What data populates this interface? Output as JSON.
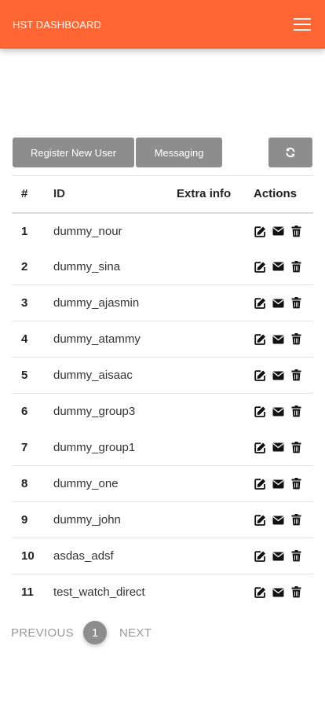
{
  "header": {
    "title": "HST DASHBOARD",
    "menu_icon": "hamburger-menu-icon",
    "background": "#ff6633"
  },
  "toolbar": {
    "register_label": "Register New User",
    "messaging_label": "Messaging",
    "refresh_icon": "refresh-icon"
  },
  "table": {
    "headers": [
      "#",
      "ID",
      "Extra info",
      "Actions"
    ],
    "rows": [
      {
        "num": "1",
        "id": "dummy_nour",
        "extra": ""
      },
      {
        "num": "2",
        "id": "dummy_sina",
        "extra": ""
      },
      {
        "num": "3",
        "id": "dummy_ajasmin",
        "extra": ""
      },
      {
        "num": "4",
        "id": "dummy_atammy",
        "extra": ""
      },
      {
        "num": "5",
        "id": "dummy_aisaac",
        "extra": ""
      },
      {
        "num": "6",
        "id": "dummy_group3",
        "extra": ""
      },
      {
        "num": "7",
        "id": "dummy_group1",
        "extra": ""
      },
      {
        "num": "8",
        "id": "dummy_one",
        "extra": ""
      },
      {
        "num": "9",
        "id": "dummy_john",
        "extra": ""
      },
      {
        "num": "10",
        "id": "asdas_adsf",
        "extra": ""
      },
      {
        "num": "11",
        "id": "test_watch_direct",
        "extra": ""
      }
    ],
    "row_actions": [
      "edit-icon",
      "envelope-icon",
      "trash-icon"
    ]
  },
  "pagination": {
    "prev_label": "PREVIOUS",
    "current_page": "1",
    "next_label": "NEXT"
  },
  "colors": {
    "accent": "#ff6633",
    "button": "#8d8d8d"
  }
}
